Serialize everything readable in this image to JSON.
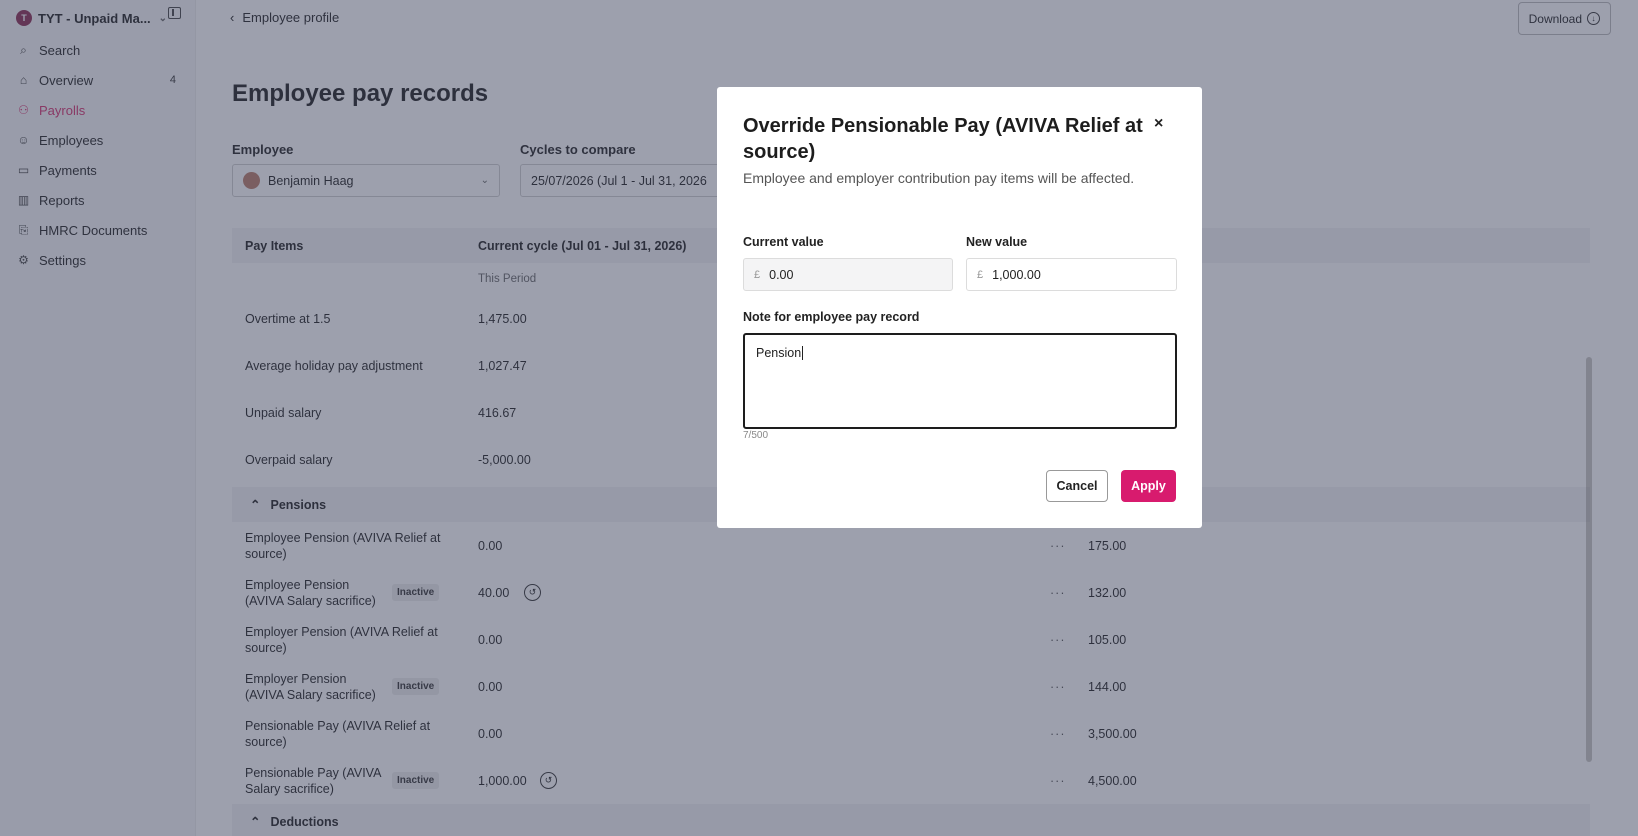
{
  "sidebar": {
    "org_initial": "T",
    "org_name": "TYT - Unpaid Ma...",
    "items": [
      {
        "label": "Search",
        "icon": "search-icon"
      },
      {
        "label": "Overview",
        "icon": "home-icon",
        "badge": "4"
      },
      {
        "label": "Payrolls",
        "icon": "payroll-icon",
        "active": true
      },
      {
        "label": "Employees",
        "icon": "user-icon"
      },
      {
        "label": "Payments",
        "icon": "card-icon"
      },
      {
        "label": "Reports",
        "icon": "chart-icon"
      },
      {
        "label": "HMRC Documents",
        "icon": "document-icon"
      },
      {
        "label": "Settings",
        "icon": "gear-icon"
      }
    ]
  },
  "header": {
    "back_label": "Employee profile",
    "download_label": "Download"
  },
  "page": {
    "title": "Employee pay records",
    "employee_label": "Employee",
    "employee_value": "Benjamin Haag",
    "cycles_label": "Cycles to compare",
    "cycles_value": "25/07/2026 (Jul 1 - Jul 31, 2026"
  },
  "table": {
    "col_pay_items": "Pay Items",
    "col_current": "Current cycle (Jul 01 - Jul 31, 2026)",
    "sub_this_period": "This Period",
    "rows": [
      {
        "label": "Overtime at 1.5",
        "value": "1,475.00"
      },
      {
        "label": "Average holiday pay adjustment",
        "value": "1,027.47"
      },
      {
        "label": "Unpaid salary",
        "value": "416.67"
      },
      {
        "label": "Overpaid salary",
        "value": "-5,000.00"
      }
    ],
    "pensions_label": "Pensions",
    "pension_rows": [
      {
        "label": "Employee Pension (AVIVA Relief at source)",
        "value": "0.00",
        "more": "···",
        "compare": "175.00"
      },
      {
        "label": "Employee Pension (AVIVA Salary sacrifice)",
        "badge": "Inactive",
        "value": "40.00",
        "more": "···",
        "compare": "132.00"
      },
      {
        "label": "Employer Pension (AVIVA Relief at source)",
        "value": "0.00",
        "more": "···",
        "compare": "105.00"
      },
      {
        "label": "Employer Pension (AVIVA Salary sacrifice)",
        "badge": "Inactive",
        "value": "0.00",
        "more": "···",
        "compare": "144.00"
      },
      {
        "label": "Pensionable Pay (AVIVA Relief at source)",
        "value": "0.00",
        "more": "···",
        "compare": "3,500.00"
      },
      {
        "label": "Pensionable Pay (AVIVA Salary sacrifice)",
        "badge": "Inactive",
        "value": "1,000.00",
        "more": "···",
        "compare": "4,500.00"
      }
    ],
    "deductions_label": "Deductions"
  },
  "modal": {
    "title": "Override Pensionable Pay (AVIVA Relief at source)",
    "close": "×",
    "description": "Employee and employer contribution pay items will be affected.",
    "current_label": "Current value",
    "current_currency": "£",
    "current_value": "0.00",
    "new_label": "New value",
    "new_currency": "£",
    "new_value": "1,000.00",
    "note_label": "Note for employee pay record",
    "note_value": "Pension",
    "char_count": "7/500",
    "cancel_label": "Cancel",
    "apply_label": "Apply"
  },
  "colors": {
    "accent": "#d81b6e",
    "overlay": "#3c425c"
  }
}
